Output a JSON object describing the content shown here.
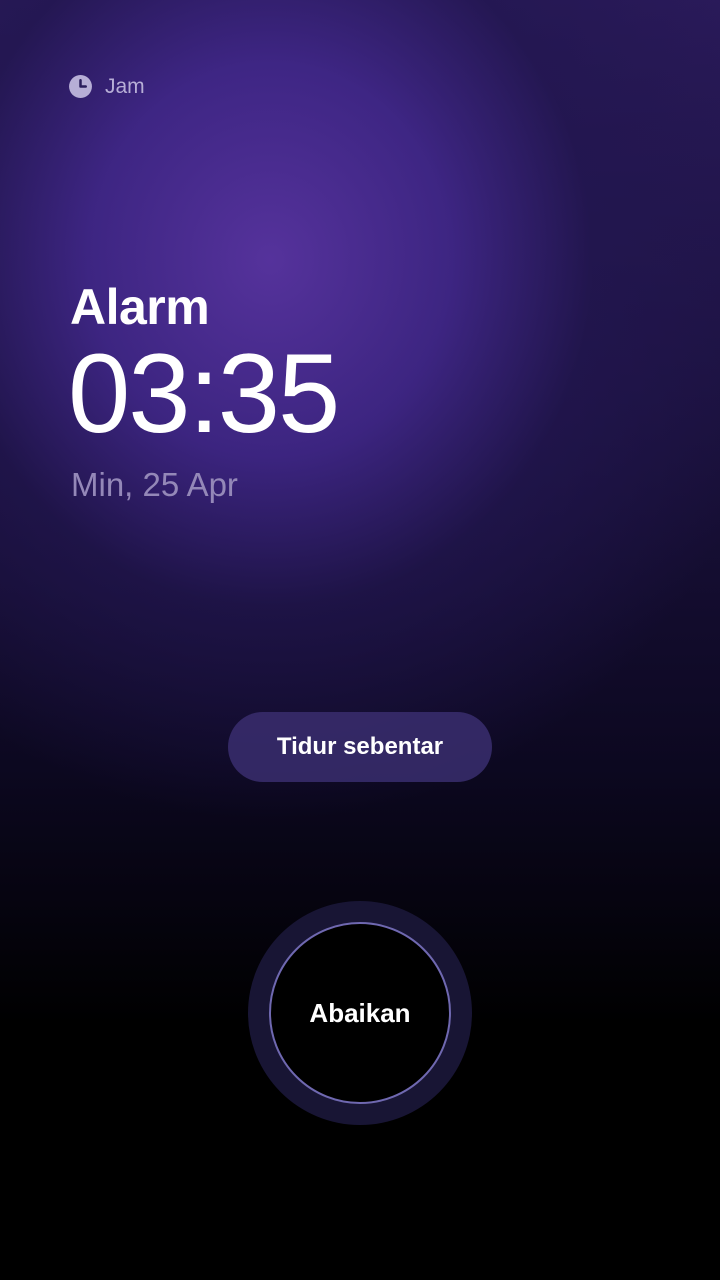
{
  "header": {
    "app_name": "Jam",
    "app_icon": "clock-icon"
  },
  "alarm": {
    "title": "Alarm",
    "time": "03:35",
    "date": "Min, 25 Apr"
  },
  "actions": {
    "snooze_label": "Tidur sebentar",
    "dismiss_label": "Abaikan"
  },
  "colors": {
    "accent_purple": "#4b3596",
    "background_dark": "#000000",
    "snooze_bg": "#3a2e6e",
    "dismiss_ring": "#6f68b0"
  }
}
